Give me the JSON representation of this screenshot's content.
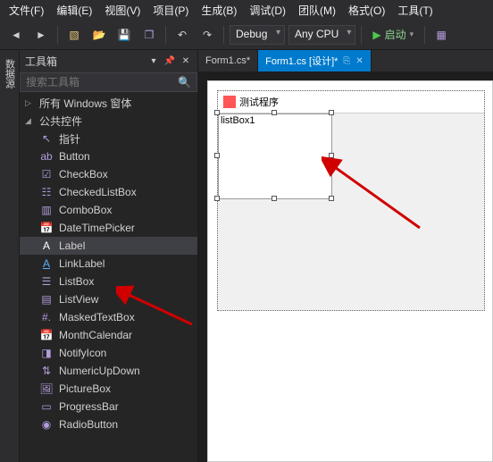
{
  "menu": {
    "file": "文件(F)",
    "edit": "编辑(E)",
    "view": "视图(V)",
    "project": "项目(P)",
    "build": "生成(B)",
    "debug": "调试(D)",
    "team": "团队(M)",
    "format": "格式(O)",
    "tools": "工具(T)"
  },
  "toolbar": {
    "config": "Debug",
    "platform": "Any CPU",
    "start": "启动"
  },
  "side_tab": {
    "label": "数据源"
  },
  "toolbox": {
    "title": "工具箱",
    "search_placeholder": "搜索工具箱",
    "group_windows": "所有 Windows 窗体",
    "group_common": "公共控件",
    "items": [
      {
        "icon": "pointer",
        "label": "指针"
      },
      {
        "icon": "button",
        "label": "Button"
      },
      {
        "icon": "checkbox",
        "label": "CheckBox"
      },
      {
        "icon": "checkedlistbox",
        "label": "CheckedListBox"
      },
      {
        "icon": "combobox",
        "label": "ComboBox"
      },
      {
        "icon": "datetime",
        "label": "DateTimePicker"
      },
      {
        "icon": "label",
        "label": "Label",
        "selected": true
      },
      {
        "icon": "linklabel",
        "label": "LinkLabel"
      },
      {
        "icon": "listbox",
        "label": "ListBox"
      },
      {
        "icon": "listview",
        "label": "ListView"
      },
      {
        "icon": "masked",
        "label": "MaskedTextBox"
      },
      {
        "icon": "month",
        "label": "MonthCalendar"
      },
      {
        "icon": "notify",
        "label": "NotifyIcon"
      },
      {
        "icon": "numeric",
        "label": "NumericUpDown"
      },
      {
        "icon": "picture",
        "label": "PictureBox"
      },
      {
        "icon": "progress",
        "label": "ProgressBar"
      },
      {
        "icon": "radio",
        "label": "RadioButton"
      }
    ]
  },
  "tabs": {
    "inactive": "Form1.cs*",
    "active": "Form1.cs [设计]*"
  },
  "form": {
    "title": "测试程序",
    "listbox_text": "listBox1"
  }
}
